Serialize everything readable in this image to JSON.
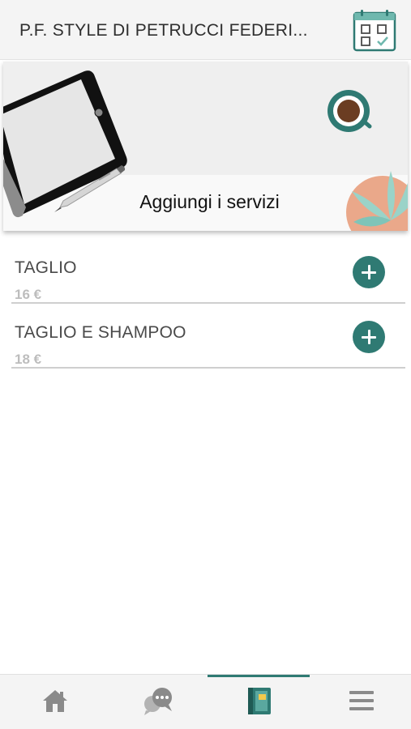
{
  "header": {
    "title": "P.F. STYLE DI PETRUCCI FEDERI..."
  },
  "banner": {
    "title": "Aggiungi i servizi"
  },
  "services": [
    {
      "name": "TAGLIO",
      "price": "16 €"
    },
    {
      "name": "TAGLIO E SHAMPOO",
      "price": "18 €"
    }
  ],
  "tabbar": {
    "tabs": [
      {
        "icon": "home-icon"
      },
      {
        "icon": "chat-icon"
      },
      {
        "icon": "notebook-icon",
        "active": true
      },
      {
        "icon": "menu-icon"
      }
    ]
  },
  "colors": {
    "accent": "#2f7a73",
    "header_bg": "#f4f4f4",
    "price_text": "#bdbdbd"
  }
}
